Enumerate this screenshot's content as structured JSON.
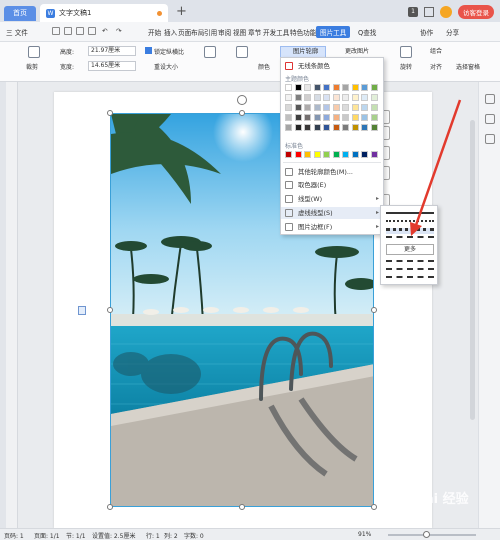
{
  "titlebar": {
    "home_tab": "首页",
    "doc_tab": "文字文稿1",
    "badge": "1",
    "visitor_label": "访客登录"
  },
  "menu": {
    "file": "三 文件",
    "items": [
      "开始",
      "插入",
      "页面布局",
      "引用",
      "审阅",
      "视图",
      "章节",
      "开发工具",
      "特色功能",
      "图片工具"
    ],
    "search": "Q查找",
    "collab": "协作",
    "share": "分享"
  },
  "ribbon": {
    "crop_label": "裁剪",
    "height_label": "高度:",
    "height_value": "21.97厘米",
    "width_label": "宽度:",
    "width_value": "14.65厘米",
    "lock_ratio": "锁定纵横比",
    "reset_size": "重设大小",
    "border_button": "图片轮廓",
    "change_picture": "更改图片",
    "rotate": "旋转",
    "align": "对齐",
    "group": "组合",
    "selection_pane": "选择窗格",
    "color_label": "颜色"
  },
  "dropdown": {
    "no_line": "无线条颜色",
    "theme_colors": "主题颜色",
    "standard_colors": "标准色",
    "more_colors": "其他轮廓颜色(M)...",
    "eyedropper": "取色器(E)",
    "line_type": "线型(W)",
    "dash_type": "虚线线型(S)",
    "picture_border": "图片边框(F)"
  },
  "theme_swatches": [
    "#ffffff",
    "#000000",
    "#e7e6e6",
    "#44546a",
    "#4472c4",
    "#ed7d31",
    "#a5a5a5",
    "#ffc000",
    "#5b9bd5",
    "#70ad47",
    "#f2f2f2",
    "#7f7f7f",
    "#d0cece",
    "#d6dce4",
    "#d9e2f3",
    "#fbe5d5",
    "#ededed",
    "#fff2cc",
    "#deebf6",
    "#e2efd9",
    "#d8d8d8",
    "#595959",
    "#aeabab",
    "#adb9ca",
    "#b4c6e7",
    "#f7cbac",
    "#dbdbdb",
    "#fee599",
    "#bdd7ee",
    "#c5e0b3",
    "#bfbfbf",
    "#3f3f3f",
    "#757070",
    "#8496b0",
    "#8eaadb",
    "#f4b183",
    "#c9c9c9",
    "#ffd965",
    "#9cc3e5",
    "#a8d08d",
    "#a5a5a5",
    "#262626",
    "#3a3838",
    "#323f4f",
    "#2f5496",
    "#c55a11",
    "#7b7b7b",
    "#bf9000",
    "#2e75b5",
    "#538135"
  ],
  "standard_swatches": [
    "#c00000",
    "#ff0000",
    "#ffc000",
    "#ffff00",
    "#92d050",
    "#00b050",
    "#00b0f0",
    "#0070c0",
    "#002060",
    "#7030a0"
  ],
  "submenu": {
    "more_label": "更多"
  },
  "statusbar": {
    "page": "页码: 1",
    "pages": "页面: 1/1",
    "section": "节: 1/1",
    "position": "设置值: 2.5厘米",
    "row": "行: 1",
    "col": "列: 2",
    "words": "字数: 0",
    "zoom": "91%",
    "zoom_fraction": 0.91
  },
  "watermark": "Bai 经验"
}
